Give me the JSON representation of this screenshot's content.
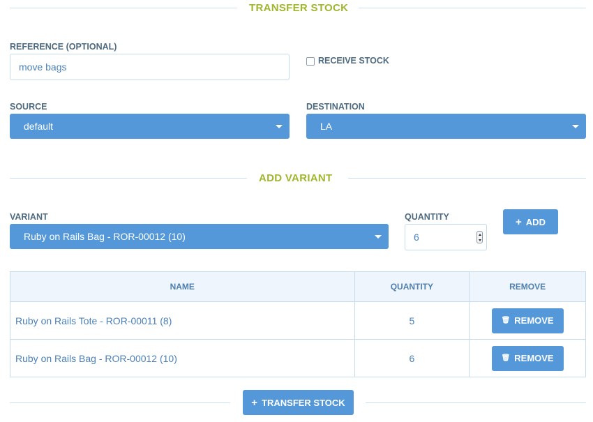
{
  "transfer_section": {
    "title": "TRANSFER STOCK",
    "reference_label": "REFERENCE (OPTIONAL)",
    "reference_value": "move bags",
    "receive_stock_label": "RECEIVE STOCK",
    "receive_stock_checked": false,
    "source_label": "SOURCE",
    "source_value": "default",
    "destination_label": "DESTINATION",
    "destination_value": "LA"
  },
  "add_variant_section": {
    "title": "ADD VARIANT",
    "variant_label": "VARIANT",
    "variant_value": "Ruby on Rails Bag - ROR-00012 (10)",
    "quantity_label": "QUANTITY",
    "quantity_value": "6",
    "add_button_label": "ADD"
  },
  "table": {
    "headers": {
      "name": "NAME",
      "quantity": "QUANTITY",
      "remove": "REMOVE"
    },
    "rows": [
      {
        "name": "Ruby on Rails Tote - ROR-00011 (8)",
        "quantity": "5",
        "remove_label": "REMOVE"
      },
      {
        "name": "Ruby on Rails Bag - ROR-00012 (10)",
        "quantity": "6",
        "remove_label": "REMOVE"
      }
    ]
  },
  "footer": {
    "transfer_button_label": "TRANSFER STOCK"
  },
  "icons": {
    "plus": "plus-icon",
    "trash": "trash-icon",
    "caret": "chevron-down-icon"
  },
  "colors": {
    "accent_blue": "#5498da",
    "section_title_green": "#9fb62f",
    "link_blue": "#4b80b9",
    "border": "#c6dbec"
  }
}
